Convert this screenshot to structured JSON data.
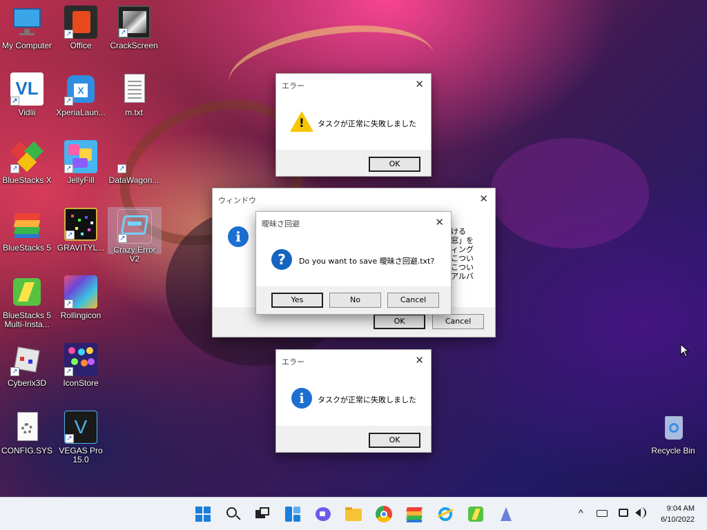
{
  "colors": {
    "accent": "#1f5fcf",
    "warning": "#f7c600",
    "info": "#1c6fd1",
    "taskbar_bg": "#eef1f6",
    "dialog_bg": "#f0f0f0"
  },
  "desktop_icons": [
    {
      "label": "My Computer"
    },
    {
      "label": "Office"
    },
    {
      "label": "CrackScreen"
    },
    {
      "label": "Vidlii"
    },
    {
      "label": "XperiaLaun..."
    },
    {
      "label": "m.txt"
    },
    {
      "label": "BlueStacks X"
    },
    {
      "label": "JellyFill"
    },
    {
      "label": "DataWagon..."
    },
    {
      "label": "BlueStacks 5"
    },
    {
      "label": "GRAVITYL..."
    },
    {
      "label": "Crazy Error V2"
    },
    {
      "label": "BlueStacks 5 Multi-Insta..."
    },
    {
      "label": "Rollingicon"
    },
    {
      "label": "Cyberix3D"
    },
    {
      "label": "IconStore"
    },
    {
      "label": "CONFIG.SYS"
    },
    {
      "label": "VEGAS Pro 15.0"
    },
    {
      "label": "Recycle Bin"
    }
  ],
  "dialogs": {
    "error_top": {
      "title": "エラー",
      "message": "タスクが正常に失敗しました",
      "ok": "OK",
      "close": "✕",
      "icon": "warning-icon"
    },
    "window": {
      "title": "ウィンドウ",
      "close": "✕",
      "ok": "OK",
      "cancel": "Cancel",
      "icon": "info-icon",
      "partial_text": [
        "ける",
        "窓」を",
        "ィング",
        "こつい",
        "こつい",
        "アルバ"
      ]
    },
    "save_prompt": {
      "title": "曖昧さ回避",
      "message": "Do you want to save 曖昧さ回避.txt?",
      "yes": "Yes",
      "no": "No",
      "cancel": "Cancel",
      "close": "✕",
      "icon": "question-icon"
    },
    "error_bottom": {
      "title": "エラー",
      "message": "タスクが正常に失敗しました",
      "ok": "OK",
      "close": "✕",
      "icon": "info-icon"
    }
  },
  "taskbar": {
    "apps": [
      "start-icon",
      "search-icon",
      "task-view-icon",
      "widgets-icon",
      "chat-icon",
      "file-explorer-icon",
      "chrome-icon",
      "bluestacks-icon",
      "internet-explorer-icon",
      "bluestacks-multi-icon",
      "aurora-icon"
    ],
    "tray": {
      "chevron": "^",
      "time": "9:04 AM",
      "date": "6/10/2022"
    }
  }
}
